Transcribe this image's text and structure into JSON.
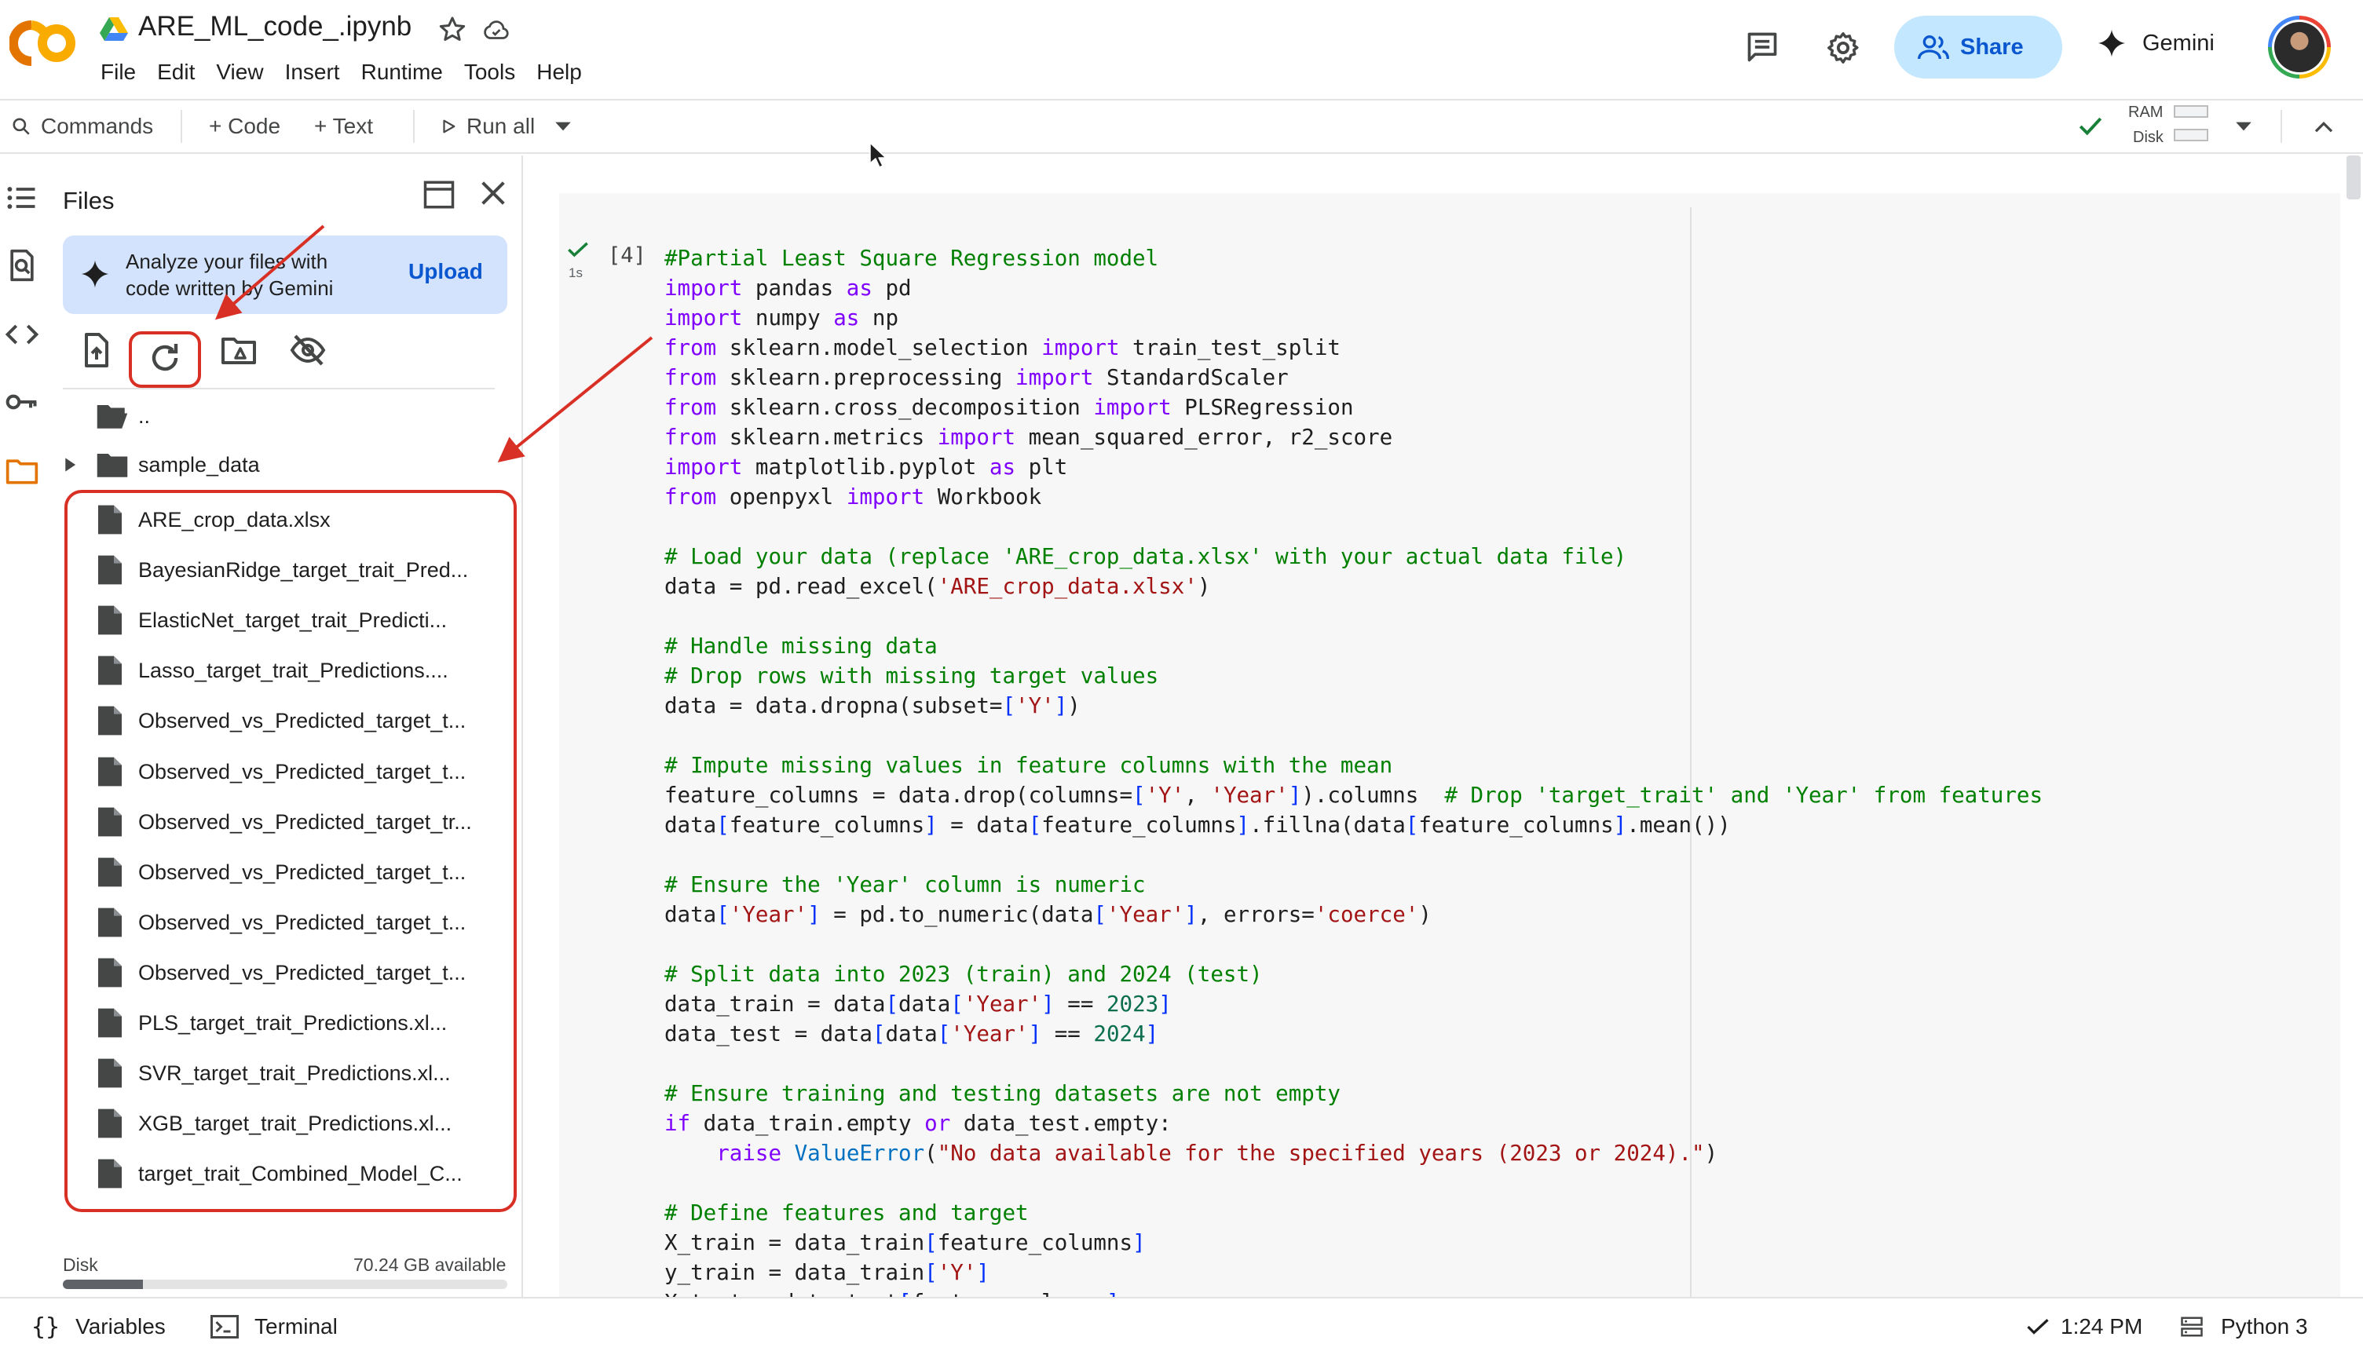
{
  "app": {
    "logo_text": "CO",
    "title": "ARE_ML_code_.ipynb",
    "menu": [
      "File",
      "Edit",
      "View",
      "Insert",
      "Runtime",
      "Tools",
      "Help"
    ],
    "share_label": "Share",
    "gemini_label": "Gemini"
  },
  "toolbar": {
    "commands_label": "Commands",
    "code_label": "+ Code",
    "text_label": "+ Text",
    "run_all_label": "Run all",
    "ram_label": "RAM",
    "disk_label": "Disk"
  },
  "files_panel": {
    "title": "Files",
    "banner_text": "Analyze your files with code written by Gemini",
    "upload_label": "Upload",
    "parent_dir": "..",
    "folder": "sample_data",
    "files": [
      "ARE_crop_data.xlsx",
      "BayesianRidge_target_trait_Pred...",
      "ElasticNet_target_trait_Predicti...",
      "Lasso_target_trait_Predictions....",
      "Observed_vs_Predicted_target_t...",
      "Observed_vs_Predicted_target_t...",
      "Observed_vs_Predicted_target_tr...",
      "Observed_vs_Predicted_target_t...",
      "Observed_vs_Predicted_target_t...",
      "Observed_vs_Predicted_target_t...",
      "PLS_target_trait_Predictions.xl...",
      "SVR_target_trait_Predictions.xl...",
      "XGB_target_trait_Predictions.xl...",
      "target_trait_Combined_Model_C..."
    ],
    "disk_label": "Disk",
    "disk_available": "70.24 GB available",
    "disk_used_fraction": 0.18
  },
  "cell": {
    "exec_count": "[4]",
    "exec_time": "1s"
  },
  "status_bar": {
    "variables_label": "Variables",
    "terminal_label": "Terminal",
    "time": "1:24 PM",
    "runtime": "Python 3"
  },
  "colors": {
    "accent": "#0b57d0",
    "share_bg": "#c2e7ff",
    "annotation_red": "#d93025",
    "logo_orange": "#f9ab00",
    "logo_dark_orange": "#e37400"
  }
}
